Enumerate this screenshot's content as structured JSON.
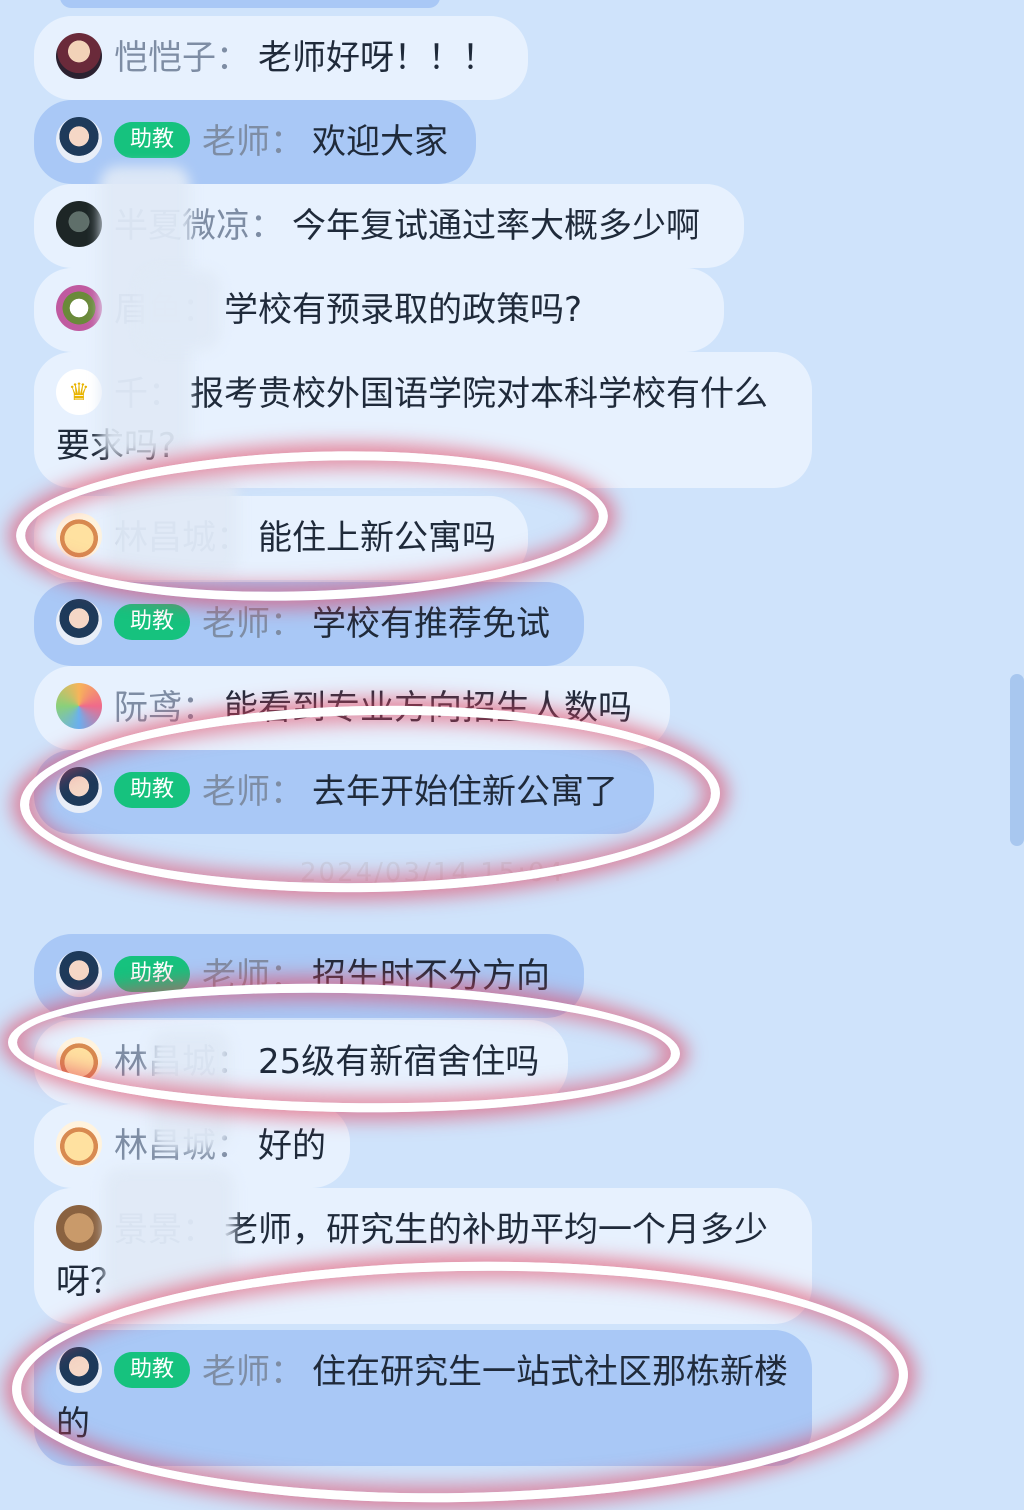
{
  "assistant_badge": "助教",
  "separator": "：",
  "timestamp": "2024/03/14 15:04",
  "messages": [
    {
      "avatar": "avatar-kaikai",
      "name": "恺恺子",
      "text": "老师好呀！！！"
    },
    {
      "avatar": "teacher-avatar",
      "badge": true,
      "name": "老师",
      "text": "欢迎大家"
    },
    {
      "avatar": "avatar-banxia",
      "name": "半夏微凉",
      "text": "今年复试通过率大概多少啊"
    },
    {
      "avatar": "avatar-flower",
      "name": "眉鱼",
      "text": "学校有预录取的政策吗?"
    },
    {
      "avatar": "crown-icon",
      "name": "千",
      "text": "报考贵校外国语学院对本科学校有什么要求吗?"
    },
    {
      "avatar": "avatar-dog",
      "name": "林昌城",
      "text": "能住上新公寓吗"
    },
    {
      "avatar": "teacher-avatar",
      "badge": true,
      "name": "老师",
      "text": "学校有推荐免试"
    },
    {
      "avatar": "avatar-rainbow",
      "name": "阮鸢",
      "text": "能看到专业方向招生人数吗"
    },
    {
      "avatar": "teacher-avatar",
      "badge": true,
      "name": "老师",
      "text": "去年开始住新公寓了"
    },
    {
      "avatar": "teacher-avatar",
      "badge": true,
      "name": "老师",
      "text": "招生时不分方向"
    },
    {
      "avatar": "avatar-dog",
      "name": "林昌城",
      "text": "25级有新宿舍住吗"
    },
    {
      "avatar": "avatar-dog",
      "name": "林昌城",
      "text": "好的"
    },
    {
      "avatar": "avatar-bear",
      "name": "景景",
      "text": "老师，研究生的补助平均一个月多少呀？"
    },
    {
      "avatar": "teacher-avatar",
      "badge": true,
      "name": "老师",
      "text": "住在研究生一站式社区那栋新楼的"
    }
  ]
}
